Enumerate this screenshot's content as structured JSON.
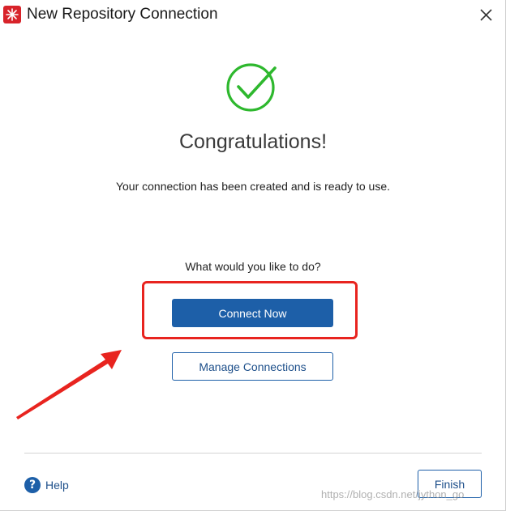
{
  "window": {
    "title": "New Repository Connection",
    "app_icon": "tableau-logo-icon",
    "close_icon": "close-icon"
  },
  "main": {
    "status_icon": "check-circle-icon",
    "heading": "Congratulations!",
    "message": "Your connection has been created and is ready to use.",
    "question": "What would you like to do?",
    "connect_now_label": "Connect Now",
    "manage_connections_label": "Manage Connections"
  },
  "footer": {
    "help_label": "Help",
    "help_icon": "question-circle-icon",
    "finish_label": "Finish"
  },
  "watermark": "https://blog.csdn.net/jython_go",
  "colors": {
    "accent": "#1d5fa8",
    "success": "#2eb82e",
    "annotation": "#e8241f",
    "title_icon": "#d8232a"
  }
}
